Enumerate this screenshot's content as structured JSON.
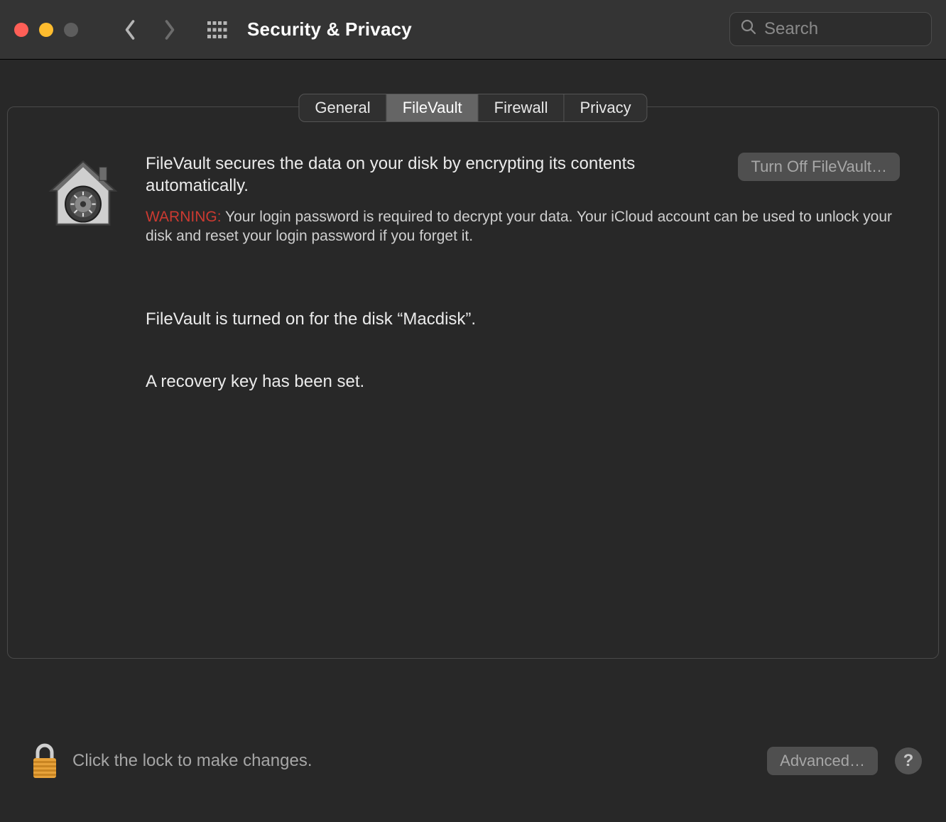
{
  "window": {
    "title": "Security & Privacy"
  },
  "search": {
    "placeholder": "Search"
  },
  "tabs": [
    {
      "label": "General"
    },
    {
      "label": "FileVault"
    },
    {
      "label": "Firewall"
    },
    {
      "label": "Privacy"
    }
  ],
  "filevault": {
    "description": "FileVault secures the data on your disk by encrypting its contents automatically.",
    "turn_off_label": "Turn Off FileVault…",
    "warning_label": "WARNING:",
    "warning_text": " Your login password is required to decrypt your data. Your iCloud account can be used to unlock your disk and reset your login password if you forget it.",
    "status": "FileVault is turned on for the disk “Macdisk”.",
    "recovery": "A recovery key has been set."
  },
  "footer": {
    "lock_text": "Click the lock to make changes.",
    "advanced_label": "Advanced…",
    "help_label": "?"
  }
}
